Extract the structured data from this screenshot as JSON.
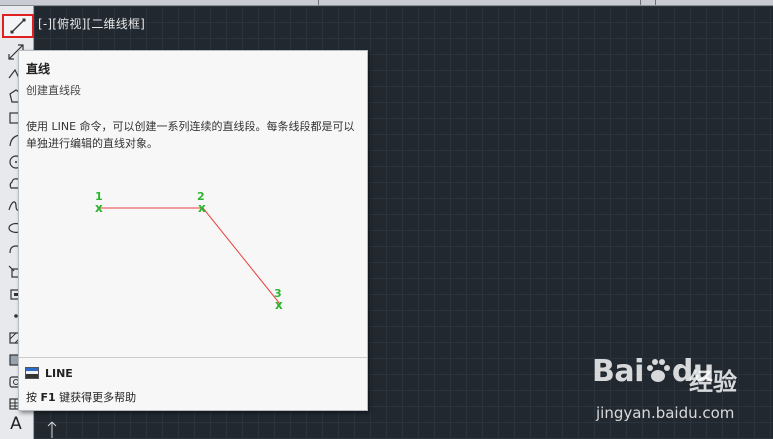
{
  "viewport": {
    "label": "[-][俯视][二维线框]"
  },
  "toolbar": {
    "tools": [
      {
        "name": "line-icon"
      },
      {
        "name": "construction-line-icon"
      },
      {
        "name": "polyline-icon"
      },
      {
        "name": "polygon-icon"
      },
      {
        "name": "rectangle-icon"
      },
      {
        "name": "arc-icon"
      },
      {
        "name": "circle-icon"
      },
      {
        "name": "revision-cloud-icon"
      },
      {
        "name": "spline-icon"
      },
      {
        "name": "ellipse-icon"
      },
      {
        "name": "ellipse-arc-icon"
      },
      {
        "name": "insert-block-icon"
      },
      {
        "name": "make-block-icon"
      },
      {
        "name": "point-icon"
      },
      {
        "name": "hatch-icon"
      },
      {
        "name": "gradient-icon"
      },
      {
        "name": "region-icon"
      },
      {
        "name": "table-icon"
      },
      {
        "name": "multiline-text-icon"
      }
    ],
    "text_tool_label": "A"
  },
  "tooltip": {
    "title": "直线",
    "subtitle": "创建直线段",
    "description": "使用 LINE 命令，可以创建一系列连续的直线段。每条线段都是可以单独进行编辑的直线对象。",
    "points": [
      "1",
      "2",
      "3"
    ],
    "marker": "x",
    "command": "LINE",
    "help_prefix": "按 ",
    "help_key": "F1",
    "help_suffix": " 键获得更多帮助",
    "line_color": "#e84040",
    "marker_color": "#2db52d"
  },
  "watermark": {
    "brand": "Bai",
    "brand_suffix": "du",
    "product": "经验",
    "url": "jingyan.baidu.com"
  }
}
